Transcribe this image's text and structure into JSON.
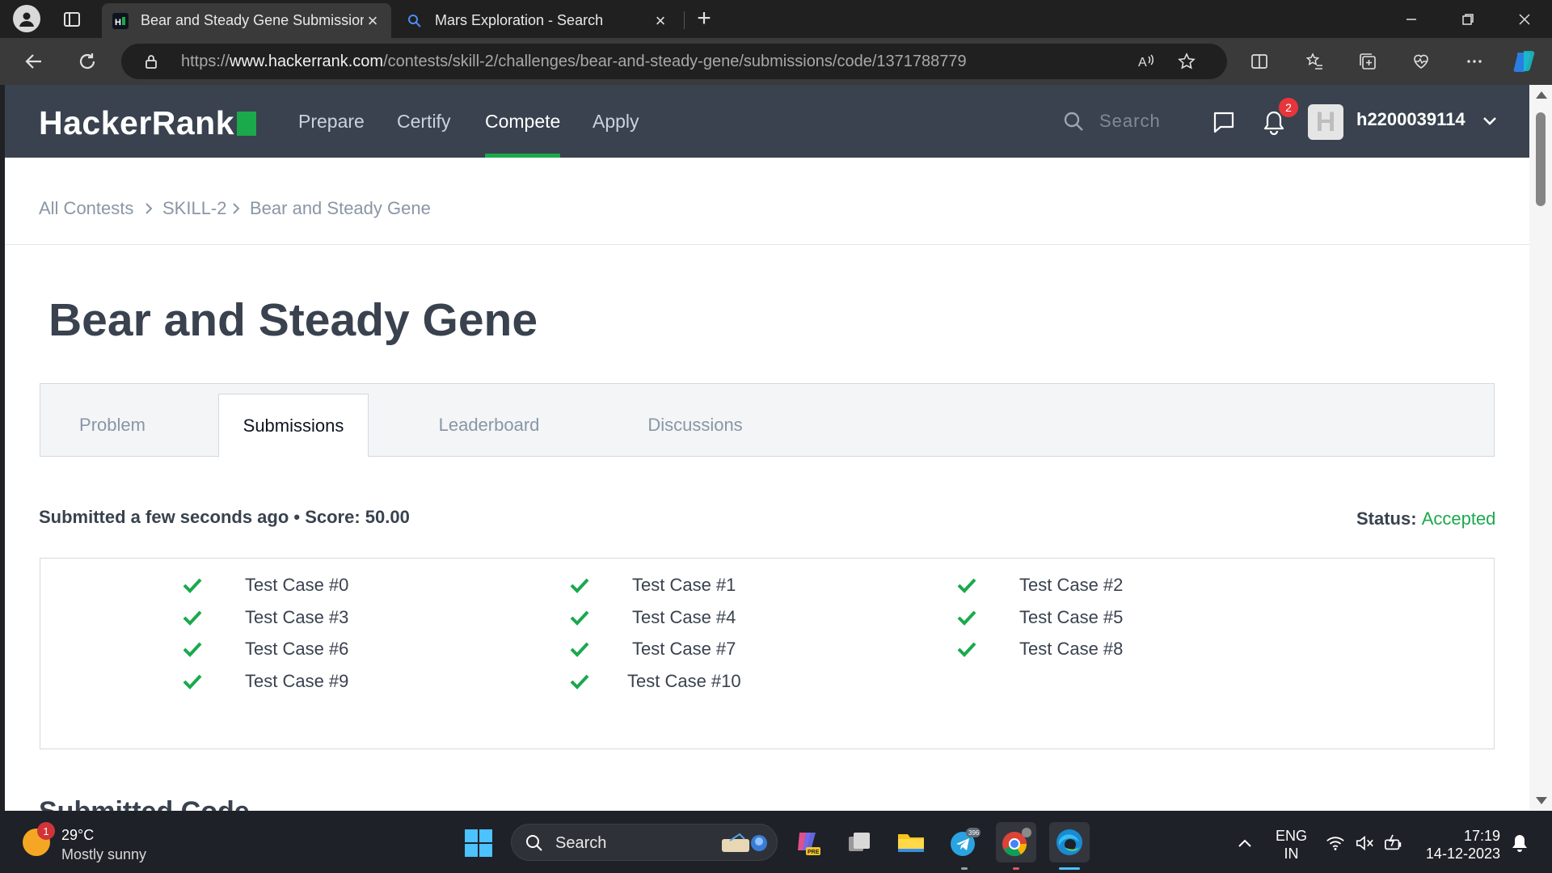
{
  "browser": {
    "tabs": [
      {
        "title": "Bear and Steady Gene Submission",
        "favicon": "hackerrank-favicon",
        "active": true
      },
      {
        "title": "Mars Exploration - Search",
        "favicon": "search-favicon",
        "active": false
      }
    ],
    "url_prefix": "https://",
    "url_host": "www.hackerrank.com",
    "url_path": "/contests/skill-2/challenges/bear-and-steady-gene/submissions/code/1371788779"
  },
  "site": {
    "logo": "HackerRank",
    "nav": [
      "Prepare",
      "Certify",
      "Compete",
      "Apply"
    ],
    "active_nav": "Compete",
    "search_placeholder": "Search",
    "notification_count": "2",
    "avatar_letter": "H",
    "username": "h2200039114"
  },
  "breadcrumb": [
    "All Contests",
    "SKILL-2",
    "Bear and Steady Gene"
  ],
  "page": {
    "title": "Bear and Steady Gene",
    "tabs": [
      "Problem",
      "Submissions",
      "Leaderboard",
      "Discussions"
    ],
    "active_tab": "Submissions",
    "submitted_info": "Submitted a few seconds ago • Score: 50.00",
    "status_label": "Status:",
    "status_value": "Accepted",
    "test_cases": [
      "Test Case #0",
      "Test Case #1",
      "Test Case #2",
      "Test Case #3",
      "Test Case #4",
      "Test Case #5",
      "Test Case #6",
      "Test Case #7",
      "Test Case #8",
      "Test Case #9",
      "Test Case #10"
    ],
    "next_section": "Submitted Code"
  },
  "colors": {
    "header_bg": "#39424e",
    "accent_green": "#1ba94c",
    "text_dark": "#39424e",
    "text_muted": "#8a96a6"
  },
  "taskbar": {
    "weather_badge": "1",
    "temperature": "29°C",
    "weather": "Mostly sunny",
    "search_label": "Search",
    "telegram_badge": "396",
    "lang_line1": "ENG",
    "lang_line2": "IN",
    "time": "17:19",
    "date": "14-12-2023"
  }
}
